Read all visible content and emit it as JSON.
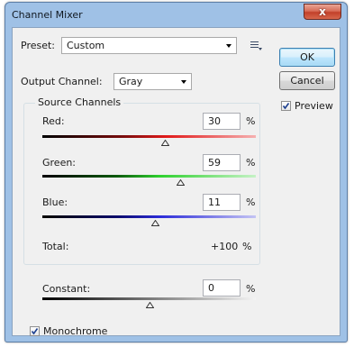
{
  "window": {
    "title": "Channel Mixer",
    "close_label": "x"
  },
  "preset": {
    "label": "Preset:",
    "value": "Custom",
    "menu_icon": "preset-options-icon"
  },
  "output_channel": {
    "label": "Output Channel:",
    "value": "Gray"
  },
  "buttons": {
    "ok": "OK",
    "cancel": "Cancel"
  },
  "preview": {
    "label": "Preview",
    "checked": true
  },
  "source_channels": {
    "title": "Source Channels",
    "red": {
      "label": "Red:",
      "value": "30",
      "unit": "%",
      "level": 30
    },
    "green": {
      "label": "Green:",
      "value": "59",
      "unit": "%",
      "level": 59
    },
    "blue": {
      "label": "Blue:",
      "value": "11",
      "unit": "%",
      "level": 11
    },
    "total": {
      "label": "Total:",
      "value": "+100",
      "unit": "%"
    }
  },
  "constant": {
    "label": "Constant:",
    "value": "0",
    "unit": "%",
    "level": 0
  },
  "monochrome": {
    "label": "Monochrome",
    "checked": true
  },
  "colors": {
    "red_end": "#e11a1a",
    "green_end": "#2ed12e",
    "blue_end": "#2b2bd8",
    "gray_end": "#f4f4f4",
    "title_bar": "#9fc1e6",
    "ok_border": "#3c7fb1"
  }
}
